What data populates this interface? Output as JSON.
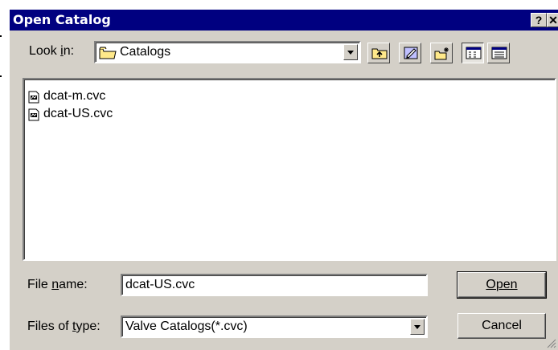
{
  "dialog": {
    "title": "Open Catalog",
    "help_button": "?",
    "close_button": "✕"
  },
  "look_in": {
    "label": "Look in:",
    "value": "Catalogs"
  },
  "toolbar": {
    "icons": [
      "up-one-level-icon",
      "desktop-icon",
      "new-folder-icon",
      "list-view-icon",
      "details-view-icon"
    ]
  },
  "files": [
    {
      "name": "dcat-m.cvc",
      "icon": "catalog-file-icon"
    },
    {
      "name": "dcat-US.cvc",
      "icon": "catalog-file-icon"
    }
  ],
  "file_name": {
    "label": "File name:",
    "value": "dcat-US.cvc"
  },
  "file_type": {
    "label": "Files of type:",
    "value": "Valve Catalogs(*.cvc)"
  },
  "buttons": {
    "open": "Open",
    "cancel": "Cancel"
  }
}
